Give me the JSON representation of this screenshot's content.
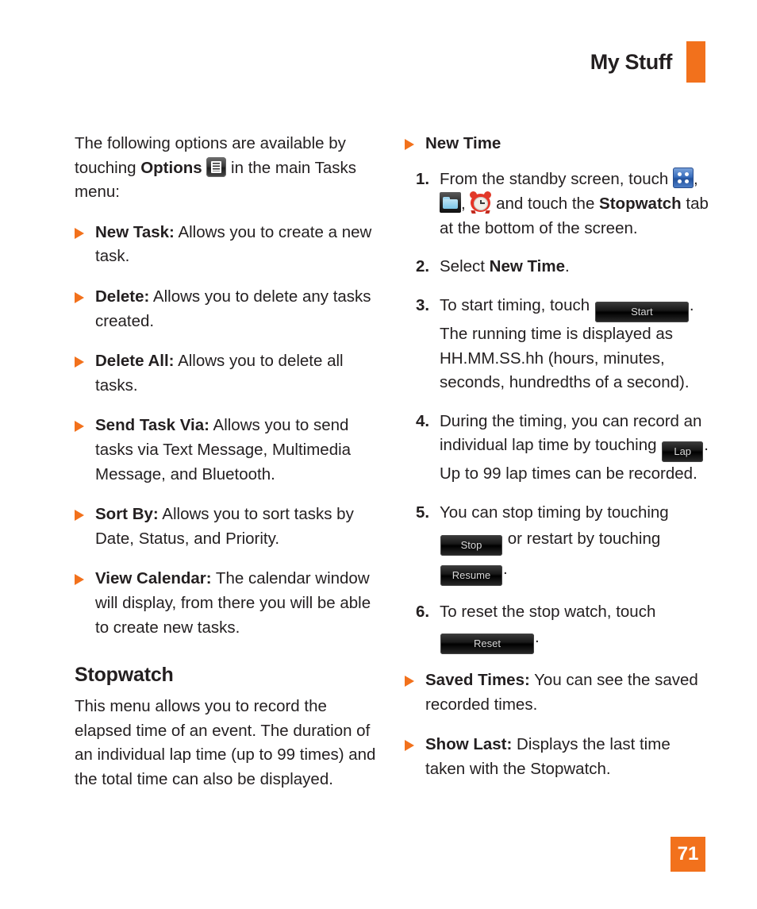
{
  "header": {
    "title": "My Stuff",
    "accent_color": "#f2711c"
  },
  "page_number": "71",
  "left_column": {
    "intro": {
      "before_bold": "The following options are available by touching ",
      "bold": "Options",
      "after_icon": " in the main Tasks menu:",
      "icon": "options-menu-icon"
    },
    "options": [
      {
        "term": "New Task:",
        "desc": " Allows you to create a new task."
      },
      {
        "term": "Delete:",
        "desc": " Allows you to delete any tasks created."
      },
      {
        "term": "Delete All:",
        "desc": " Allows you to delete all tasks."
      },
      {
        "term": "Send Task Via:",
        "desc": " Allows you to send tasks via Text Message, Multimedia Message, and Bluetooth."
      },
      {
        "term": "Sort By:",
        "desc": " Allows you to sort tasks by Date, Status, and Priority."
      },
      {
        "term": "View Calendar:",
        "desc": " The calendar window will display, from there you will be able to create new tasks."
      }
    ],
    "section": {
      "heading": "Stopwatch",
      "body": "This menu allows you to record the elapsed time of an event. The duration of an individual lap time (up to 99 times) and the total time can also be displayed."
    }
  },
  "right_column": {
    "new_time_heading": "New Time",
    "steps": [
      {
        "num": "1.",
        "part1": "From the standby screen, touch ",
        "icon1": "grid-menu-icon",
        "sep1": ", ",
        "icon2": "folder-icon",
        "sep2": ", ",
        "icon3": "alarm-clock-icon",
        "part2": " and touch the ",
        "bold": "Stopwatch",
        "part3": " tab at the bottom of the screen."
      },
      {
        "num": "2.",
        "part1": "Select ",
        "bold": "New Time",
        "part2": "."
      },
      {
        "num": "3.",
        "part1": "To start timing, touch ",
        "button": "Start",
        "part2": ". The running time is displayed as HH.MM.SS.hh (hours, minutes, seconds, hundredths of a second)."
      },
      {
        "num": "4.",
        "part1": "During the timing, you can record an individual lap time by touching ",
        "button": "Lap",
        "part2": ". Up to 99 lap times can be recorded."
      },
      {
        "num": "5.",
        "part1": "You can stop timing by touching ",
        "button1": "Stop",
        "part2": " or restart by touching ",
        "button2": "Resume",
        "part3": "."
      },
      {
        "num": "6.",
        "part1": "To reset the stop watch, touch ",
        "button": "Reset",
        "part2": "."
      }
    ],
    "options": [
      {
        "term": "Saved Times:",
        "desc": " You can see the saved recorded times."
      },
      {
        "term": "Show Last:",
        "desc": " Displays the last time taken with the Stopwatch."
      }
    ]
  }
}
